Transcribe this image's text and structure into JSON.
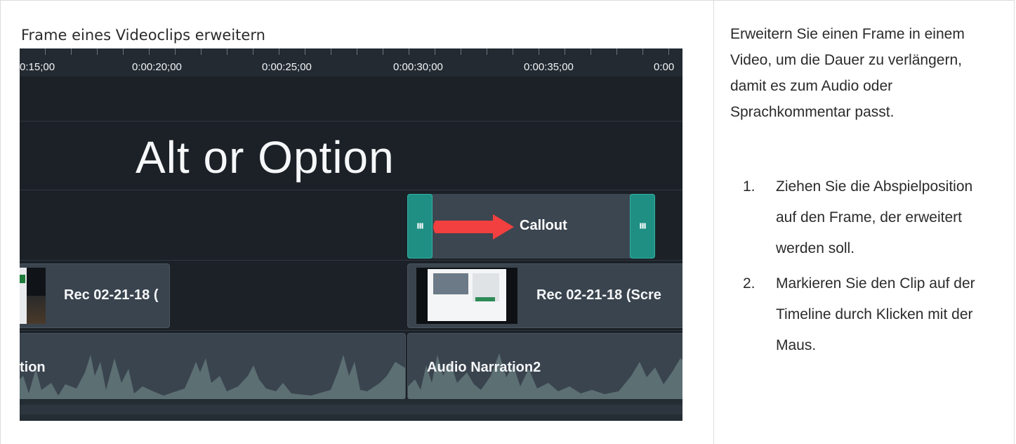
{
  "heading": "Frame eines Videoclips erweitern",
  "timeline": {
    "ruler_labels": [
      "0:15;00",
      "0:00:20;00",
      "0:00:25;00",
      "0:00:30;00",
      "0:00:35;00",
      "0:00"
    ],
    "caption_text": "Alt or Option",
    "callout_label": "Callout",
    "handle_grip": "III",
    "video_clips": [
      {
        "label": "Rec 02-21-18 ("
      },
      {
        "label": "Rec 02-21-18 (Scre"
      }
    ],
    "audio_clips": [
      {
        "label": "tion"
      },
      {
        "label": "Audio Narration2"
      }
    ],
    "colors": {
      "background": "#1b2127",
      "handle": "#1f8f83",
      "arrow": "#f23f3f"
    }
  },
  "instructions": {
    "intro": "Erweitern Sie einen Frame in einem Video, um die Dauer zu verlängern, damit es zum Audio oder Sprachkommentar passt.",
    "steps": [
      {
        "num": "1.",
        "text": "Ziehen Sie die Abspielposition auf den Frame, der erweitert werden soll."
      },
      {
        "num": "2.",
        "text": "Markieren Sie den Clip auf der Timeline durch Klicken mit der Maus."
      }
    ]
  }
}
